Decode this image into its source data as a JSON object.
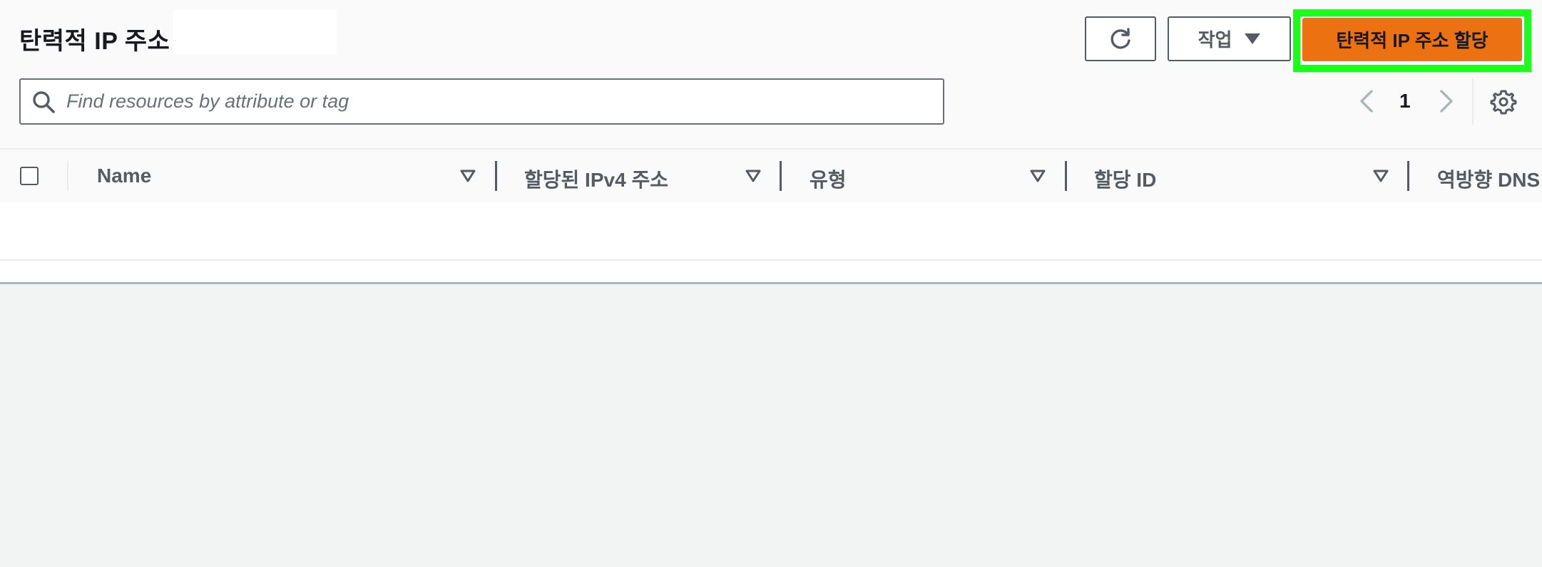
{
  "header": {
    "title": "탄력적 IP 주소"
  },
  "toolbar": {
    "refresh_icon": "refresh-icon",
    "actions_label": "작업",
    "allocate_label": "탄력적 IP 주소 할당"
  },
  "search": {
    "placeholder": "Find resources by attribute or tag"
  },
  "pagination": {
    "current_page": "1"
  },
  "table": {
    "columns": [
      {
        "label": "Name"
      },
      {
        "label": "할당된 IPv4 주소"
      },
      {
        "label": "유형"
      },
      {
        "label": "할당 ID"
      },
      {
        "label": "역방향 DNS"
      }
    ],
    "rows": []
  },
  "colors": {
    "primary": "#ec7211",
    "highlight": "#1aff1a",
    "text": "#16191f",
    "muted": "#545b64"
  }
}
